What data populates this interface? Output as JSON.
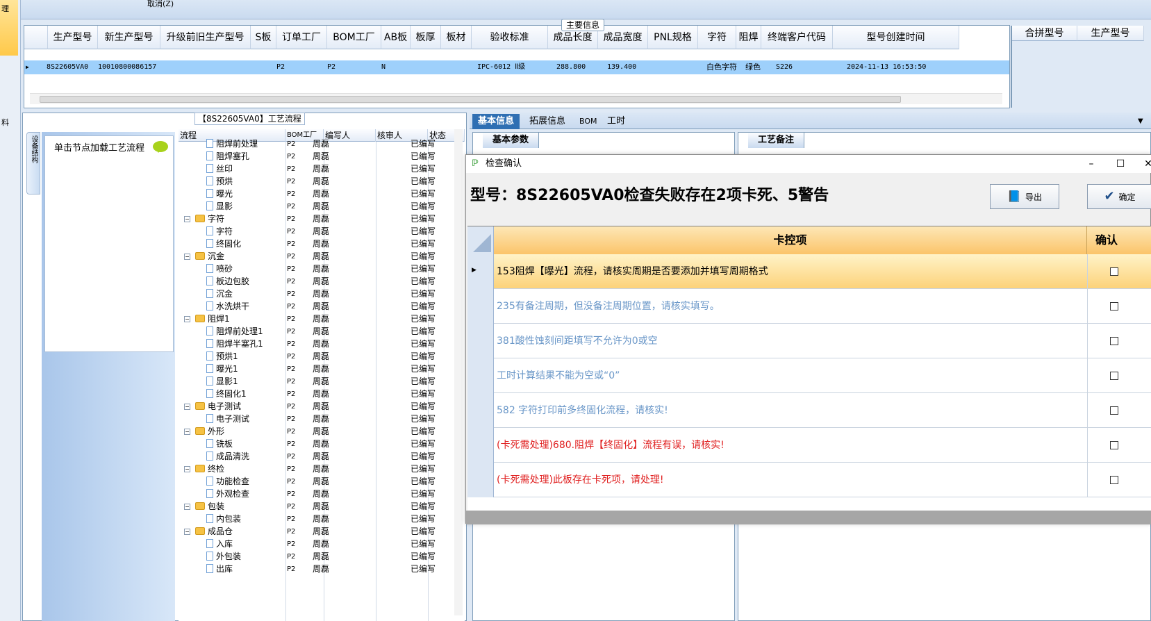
{
  "top": {
    "left_label_1": "理",
    "left_label_2": "料",
    "cancel": "取消(Z)"
  },
  "main_info": {
    "title": "主要信息",
    "columns": [
      "生产型号",
      "新生产型号",
      "升级前旧生产型号",
      "S板",
      "订单工厂",
      "BOM工厂",
      "AB板",
      "板厚",
      "板材",
      "验收标准",
      "成品长度",
      "成品宽度",
      "PNL规格",
      "字符",
      "阻焊",
      "终端客户代码",
      "型号创建时间"
    ],
    "row": {
      "prod_model": "8S22605VA0",
      "new_model": "10010800086157",
      "order_factory": "P2",
      "bom_factory": "P2",
      "ab": "N",
      "standard": "IPC-6012 Ⅱ级",
      "length": "288.800",
      "width": "139.400",
      "char": "白色字符",
      "solder": "绿色",
      "customer": "S226",
      "created": "2024-11-13 16:53:50"
    },
    "merge_cols": [
      "合拼型号",
      "生产型号"
    ]
  },
  "left": {
    "vtab": "设备结构",
    "hint": "单击节点加载工艺流程",
    "flow_title": "【8S22605VA0】工艺流程"
  },
  "tree": {
    "columns": [
      "流程",
      "BOM工厂",
      "编写人",
      "核审人",
      "状态"
    ],
    "rows": [
      {
        "name": "阻焊前处理",
        "type": "doc",
        "factory": "P2",
        "author": "周磊",
        "status": "已编写"
      },
      {
        "name": "阻焊塞孔",
        "type": "doc",
        "factory": "P2",
        "author": "周磊",
        "status": "已编写"
      },
      {
        "name": "丝印",
        "type": "doc",
        "factory": "P2",
        "author": "周磊",
        "status": "已编写"
      },
      {
        "name": "预烘",
        "type": "doc",
        "factory": "P2",
        "author": "周磊",
        "status": "已编写"
      },
      {
        "name": "曝光",
        "type": "doc",
        "factory": "P2",
        "author": "周磊",
        "status": "已编写"
      },
      {
        "name": "显影",
        "type": "doc",
        "factory": "P2",
        "author": "周磊",
        "status": "已编写"
      },
      {
        "name": "字符",
        "type": "folder",
        "factory": "P2",
        "author": "周磊",
        "status": "已编写"
      },
      {
        "name": "字符",
        "type": "doc",
        "factory": "P2",
        "author": "周磊",
        "status": "已编写"
      },
      {
        "name": "终固化",
        "type": "doc",
        "factory": "P2",
        "author": "周磊",
        "status": "已编写"
      },
      {
        "name": "沉金",
        "type": "folder",
        "factory": "P2",
        "author": "周磊",
        "status": "已编写"
      },
      {
        "name": "喷砂",
        "type": "doc",
        "factory": "P2",
        "author": "周磊",
        "status": "已编写"
      },
      {
        "name": "板边包胶",
        "type": "doc",
        "factory": "P2",
        "author": "周磊",
        "status": "已编写"
      },
      {
        "name": "沉金",
        "type": "doc",
        "factory": "P2",
        "author": "周磊",
        "status": "已编写"
      },
      {
        "name": "水洗烘干",
        "type": "doc",
        "factory": "P2",
        "author": "周磊",
        "status": "已编写"
      },
      {
        "name": "阻焊1",
        "type": "folder",
        "factory": "P2",
        "author": "周磊",
        "status": "已编写"
      },
      {
        "name": "阻焊前处理1",
        "type": "doc",
        "factory": "P2",
        "author": "周磊",
        "status": "已编写"
      },
      {
        "name": "阻焊半塞孔1",
        "type": "doc",
        "factory": "P2",
        "author": "周磊",
        "status": "已编写"
      },
      {
        "name": "预烘1",
        "type": "doc",
        "factory": "P2",
        "author": "周磊",
        "status": "已编写"
      },
      {
        "name": "曝光1",
        "type": "doc",
        "factory": "P2",
        "author": "周磊",
        "status": "已编写"
      },
      {
        "name": "显影1",
        "type": "doc",
        "factory": "P2",
        "author": "周磊",
        "status": "已编写"
      },
      {
        "name": "终固化1",
        "type": "doc",
        "factory": "P2",
        "author": "周磊",
        "status": "已编写"
      },
      {
        "name": "电子测试",
        "type": "folder",
        "factory": "P2",
        "author": "周磊",
        "status": "已编写"
      },
      {
        "name": "电子测试",
        "type": "doc",
        "factory": "P2",
        "author": "周磊",
        "status": "已编写"
      },
      {
        "name": "外形",
        "type": "folder",
        "factory": "P2",
        "author": "周磊",
        "status": "已编写"
      },
      {
        "name": "铣板",
        "type": "doc",
        "factory": "P2",
        "author": "周磊",
        "status": "已编写"
      },
      {
        "name": "成品清洗",
        "type": "doc",
        "factory": "P2",
        "author": "周磊",
        "status": "已编写"
      },
      {
        "name": "终检",
        "type": "folder",
        "factory": "P2",
        "author": "周磊",
        "status": "已编写"
      },
      {
        "name": "功能检查",
        "type": "doc",
        "factory": "P2",
        "author": "周磊",
        "status": "已编写"
      },
      {
        "name": "外观检查",
        "type": "doc",
        "factory": "P2",
        "author": "周磊",
        "status": "已编写"
      },
      {
        "name": "包装",
        "type": "folder",
        "factory": "P2",
        "author": "周磊",
        "status": "已编写"
      },
      {
        "name": "内包装",
        "type": "doc",
        "factory": "P2",
        "author": "周磊",
        "status": "已编写"
      },
      {
        "name": "成品仓",
        "type": "folder",
        "factory": "P2",
        "author": "周磊",
        "status": "已编写"
      },
      {
        "name": "入库",
        "type": "doc",
        "factory": "P2",
        "author": "周磊",
        "status": "已编写"
      },
      {
        "name": "外包装",
        "type": "doc",
        "factory": "P2",
        "author": "周磊",
        "status": "已编写"
      },
      {
        "name": "出库",
        "type": "doc",
        "factory": "P2",
        "author": "周磊",
        "status": "已编写"
      }
    ]
  },
  "right_tabs": [
    "基本信息",
    "拓展信息",
    "BOM",
    "工时"
  ],
  "right_subtabs": {
    "basic": "基本参数",
    "notes": "工艺备注"
  },
  "dialog": {
    "title": "检查确认",
    "message": "型号：8S22605VA0检查失败存在2项卡死、5警告",
    "export": "导出",
    "confirm": "确定",
    "col_item": "卡控项",
    "col_confirm": "确认",
    "items": [
      {
        "text": "153阻焊【曝光】流程，请核实周期是否要添加并填写周期格式",
        "color": "#000000"
      },
      {
        "text": "235有备注周期，但没备注周期位置，请核实填写。",
        "color": "#6a97c8"
      },
      {
        "text": "381酸性蚀刻间距填写不允许为0或空",
        "color": "#6a97c8"
      },
      {
        "text": "工时计算结果不能为空或“0”",
        "color": "#6a97c8"
      },
      {
        "text": "582 字符打印前多终固化流程，请核实!",
        "color": "#6a97c8"
      },
      {
        "text": "(卡死需处理)680.阻焊【终固化】流程有误，请核实!",
        "color": "#e02020"
      },
      {
        "text": "(卡死需处理)此板存在卡死项，请处理!",
        "color": "#e02020"
      }
    ]
  }
}
